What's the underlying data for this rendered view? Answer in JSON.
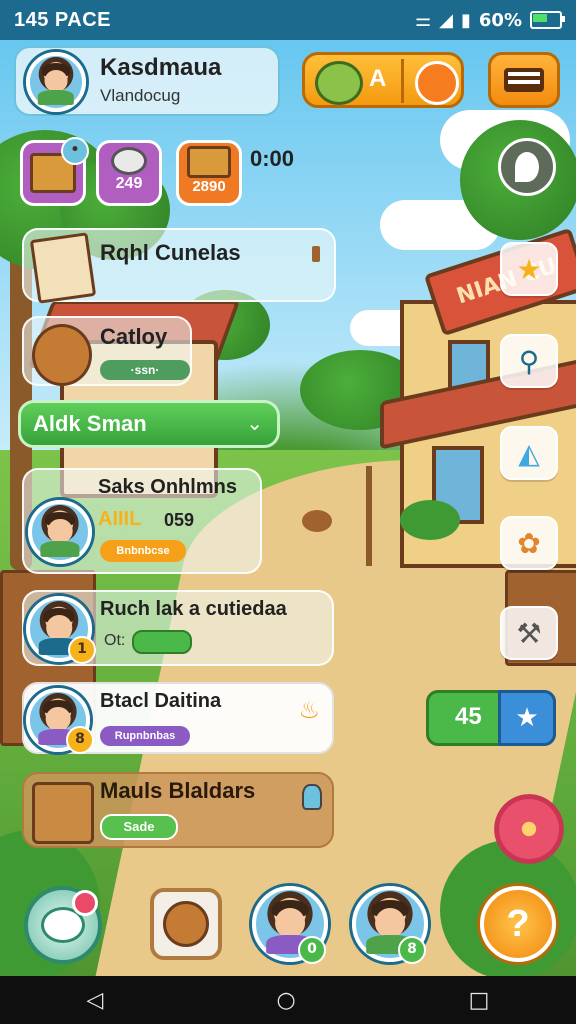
{
  "status_bar": {
    "time": "145 PACE",
    "battery_text": "60%",
    "battery_level": 0.6
  },
  "profile": {
    "name": "Kasdmaua",
    "subtitle": "Vlandocug"
  },
  "header_actions": {
    "currency_label": "A"
  },
  "quick_items": [
    {
      "icon": "crate-icon",
      "value": ""
    },
    {
      "icon": "gem-icon",
      "value": "249"
    },
    {
      "icon": "tool-crate-icon",
      "value": "2890"
    }
  ],
  "timer": "0:00",
  "tasks": {
    "header_title": "Rqhl Cunelas",
    "item1": {
      "title": "Catloy",
      "tag": "·ssn·"
    },
    "dropdown_label": "Aldk Sman",
    "item2": {
      "title": "Saks Onhlmns",
      "stat_label": "AIIIL",
      "stat_value": "059",
      "tag": "Bnbnbcse"
    },
    "item3": {
      "title": "Ruch lak a cutiedaa",
      "stat_label": "Ot:",
      "badge": "1"
    },
    "item4": {
      "title": "Btacl Daitina",
      "tag": "Rupnbnbas",
      "badge": "8"
    },
    "item5": {
      "title": "Mauls Blaldars",
      "tag": "Sade"
    }
  },
  "score_box": {
    "value": "45"
  },
  "shop_sign": "NIAN CU",
  "bottom_bar": {
    "badge1": "0",
    "badge2": "8",
    "help": "?"
  },
  "colors": {
    "accent_orange": "#f6a019",
    "accent_green": "#4bb84a",
    "panel_blue": "#1d6b8c"
  }
}
